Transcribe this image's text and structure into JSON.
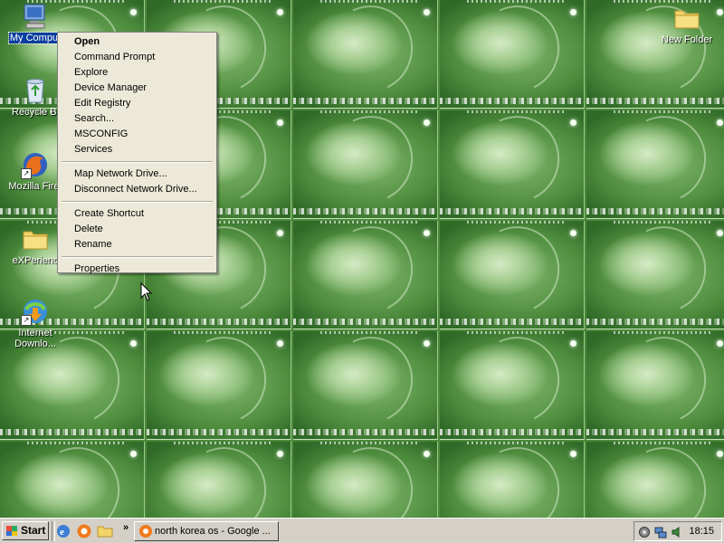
{
  "desktop": {
    "icons": [
      {
        "label": "My Comput",
        "icon": "my-computer-icon",
        "selected": true
      },
      {
        "label": "Recycle Bi",
        "icon": "recycle-bin-icon"
      },
      {
        "label": "Mozilla Firef",
        "icon": "firefox-icon"
      },
      {
        "label": "eXPerienc",
        "icon": "folder-icon"
      },
      {
        "label": "Internet",
        "label2": "Downlo...",
        "icon": "internet-download-manager-icon"
      },
      {
        "label": "New Folder",
        "icon": "folder-icon"
      }
    ]
  },
  "context_menu": {
    "items": [
      {
        "label": "Open",
        "bold": true
      },
      {
        "label": "Command Prompt"
      },
      {
        "label": "Explore"
      },
      {
        "label": "Device Manager"
      },
      {
        "label": "Edit Registry"
      },
      {
        "label": "Search..."
      },
      {
        "label": "MSCONFIG"
      },
      {
        "label": "Services"
      },
      {
        "label": "Map Network Drive..."
      },
      {
        "label": "Disconnect Network Drive..."
      },
      {
        "label": "Create Shortcut"
      },
      {
        "label": "Delete"
      },
      {
        "label": "Rename"
      },
      {
        "label": "Properties"
      }
    ]
  },
  "taskbar": {
    "start_label": "Start",
    "overflow_label": "»",
    "task_label": "north korea os - Google ...",
    "clock": "18:15"
  },
  "colors": {
    "wallpaper_green": "#4d8a3c",
    "selection_blue": "#0b3e9e",
    "menu_bg": "#ece9d8",
    "taskbar_bg": "#d4d0c8"
  }
}
